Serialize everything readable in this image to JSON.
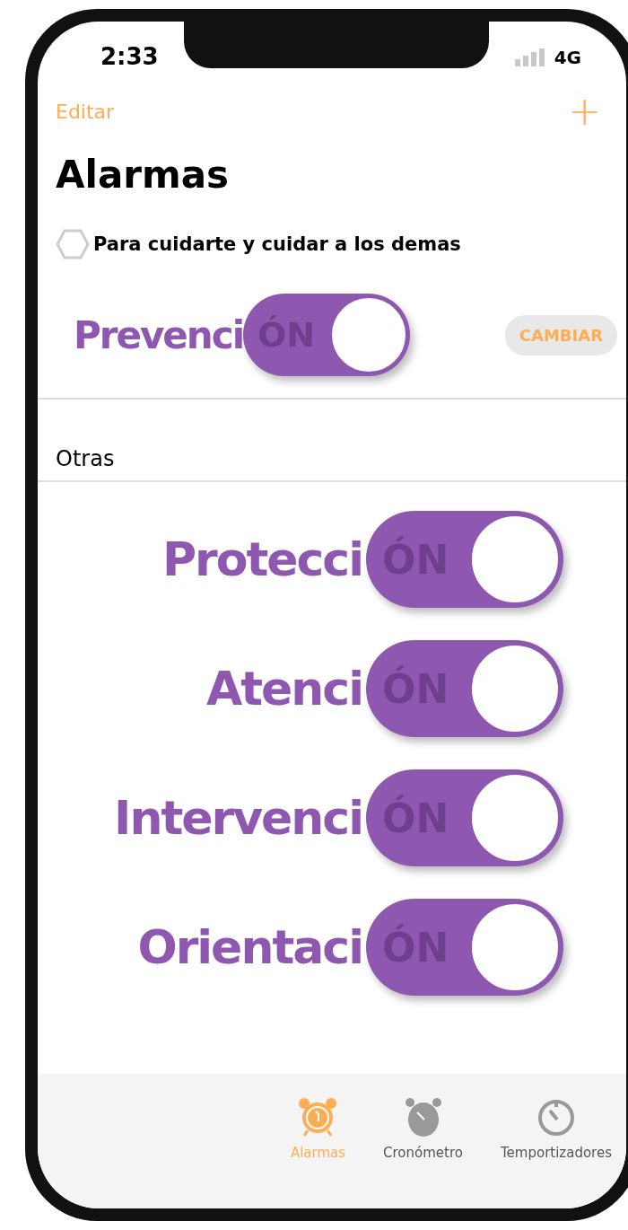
{
  "status_bar": {
    "time": "2:33",
    "network": "4G"
  },
  "nav": {
    "edit": "Editar",
    "add": "+"
  },
  "title": "Alarmas",
  "subtitle": "Para cuidarte y cuidar a los demas",
  "main_toggle": {
    "label": "Prevenci",
    "switch_text": "ÓN",
    "on": true,
    "action": "CAMBIAR"
  },
  "section": "Otras",
  "toggles": [
    {
      "label": "Protecci",
      "switch_text": "ÓN",
      "on": true
    },
    {
      "label": "Atenci",
      "switch_text": "ÓN",
      "on": true
    },
    {
      "label": "Intervenci",
      "switch_text": "ÓN",
      "on": true
    },
    {
      "label": "Orientaci",
      "switch_text": "ÓN",
      "on": true
    }
  ],
  "tabs": [
    {
      "label": "Alarmas",
      "kind": "alarm",
      "selected": true
    },
    {
      "label": "Cronómetro",
      "kind": "stopwatch",
      "selected": false
    },
    {
      "label": "Temportizadores",
      "kind": "timer",
      "selected": false
    }
  ]
}
